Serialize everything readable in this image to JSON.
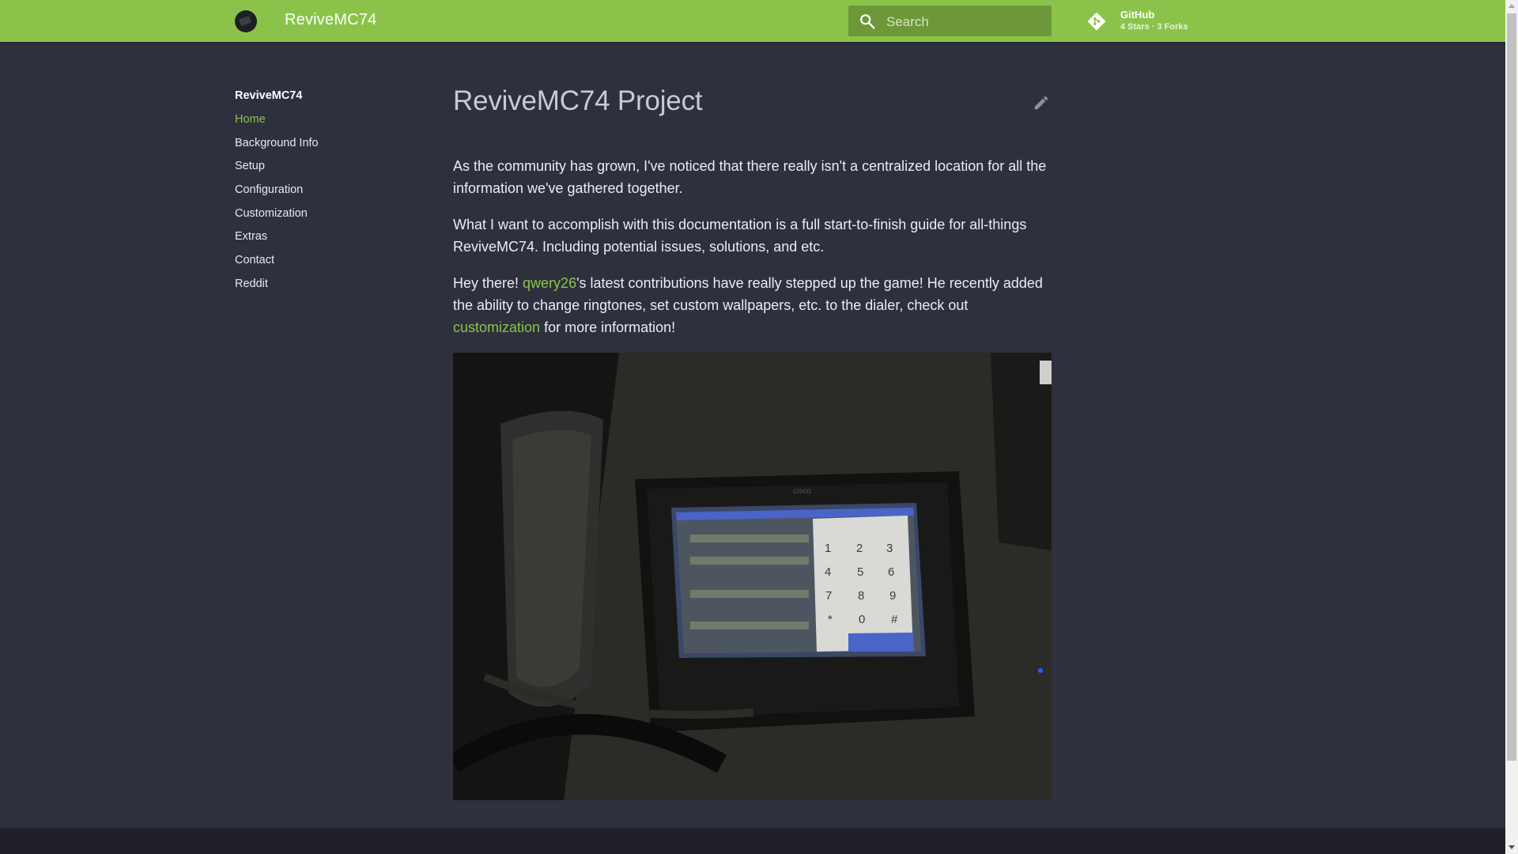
{
  "header": {
    "site_title": "ReviveMC74",
    "search": {
      "placeholder": "Search"
    },
    "repo": {
      "name": "GitHub",
      "facts": "4 Stars · 3 Forks"
    },
    "accent_color": "#8bc34a"
  },
  "sidebar": {
    "title": "ReviveMC74",
    "items": [
      {
        "label": "Home",
        "active": true
      },
      {
        "label": "Background Info"
      },
      {
        "label": "Setup"
      },
      {
        "label": "Configuration"
      },
      {
        "label": "Customization"
      },
      {
        "label": "Extras"
      },
      {
        "label": "Contact"
      },
      {
        "label": "Reddit"
      }
    ]
  },
  "main": {
    "title": "ReviveMC74 Project",
    "p1": "As the community has grown, I've noticed that there really isn't a centralized location for all the information we've gathered together.",
    "p2": "What I want to accomplish with this documentation is a full start-to-finish guide for all-things ReviveMC74. Including potential issues, solutions, and etc.",
    "p3": {
      "before": "Hey there! ",
      "link1": "qwery26",
      "middle": "'s latest contributions have really stepped up the game! He recently added the ability to change ringtones, set custom wallpapers, etc. to the dialer, check out ",
      "link2": "customization",
      "after": " for more information!"
    },
    "photo": {
      "keypad": [
        "1",
        "2",
        "3",
        "4",
        "5",
        "6",
        "7",
        "8",
        "9",
        "*",
        "0",
        "#"
      ]
    }
  }
}
